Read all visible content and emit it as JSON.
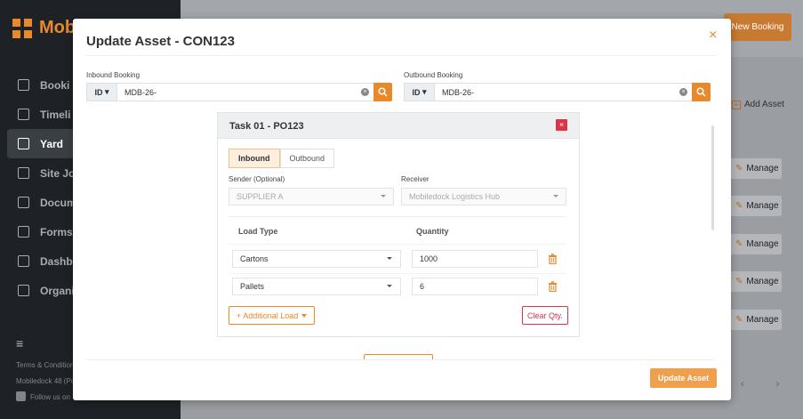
{
  "app": {
    "brand": "Mob",
    "sidebar_items": [
      {
        "label": "Booki"
      },
      {
        "label": "Timeli"
      },
      {
        "label": "Yard"
      },
      {
        "label": "Site Jo"
      },
      {
        "label": "Docum"
      },
      {
        "label": "Forms"
      },
      {
        "label": "Dashb"
      },
      {
        "label": "Organi"
      }
    ],
    "footer": {
      "terms": "Terms & Condition",
      "version": "Mobiledock 48 (Pc",
      "follow": "Follow us on"
    },
    "new_booking_label": "New Booking",
    "add_asset_label": "Add Asset",
    "manage_label": "Manage",
    "pager": "‹ ›"
  },
  "modal": {
    "title": "Update Asset - CON123",
    "close_icon": "×",
    "inbound_label": "Inbound Booking",
    "outbound_label": "Outbound Booking",
    "id_type": "ID",
    "inbound_value": "MDB-26-",
    "outbound_value": "MDB-26-",
    "task": {
      "title": "Task 01 - PO123",
      "tabs": [
        "Inbound",
        "Outbound"
      ],
      "sender_label": "Sender (Optional)",
      "sender_value": "SUPPLIER A",
      "receiver_label": "Receiver",
      "receiver_value": "Mobiledock Logistics Hub",
      "load_type_header": "Load Type",
      "quantity_header": "Quantity",
      "loads": [
        {
          "type": "Cartons",
          "quantity": "1000"
        },
        {
          "type": "Pallets",
          "quantity": "6"
        }
      ],
      "add_load_label": "+ Additional Load",
      "clear_qty_label": "Clear Qty."
    },
    "update_label": "Update Asset"
  },
  "colors": {
    "accent": "#e8892c",
    "danger": "#d9344a"
  }
}
